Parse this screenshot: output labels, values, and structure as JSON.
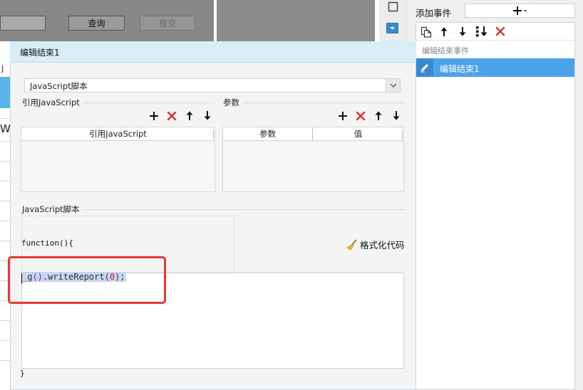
{
  "background_form": {
    "query_label": "查询",
    "submit_label": "提交",
    "left_letter_j": "J",
    "left_letter_w": "W."
  },
  "event_panel": {
    "add_event_label": "添加事件",
    "add_event_dropdown_icon": "plus-icon",
    "toolbar_icons": [
      "copy-icon",
      "arrow-up-icon",
      "arrow-down-icon",
      "move-to-bottom-icon",
      "delete-icon"
    ],
    "category_label": "编辑结束事件",
    "events": [
      {
        "label": "编辑结束1",
        "selected": true,
        "icon": "pencil-icon"
      }
    ]
  },
  "dialog": {
    "title": "编辑结束1",
    "type_select_value": "JavaScript脚本",
    "ref_js": {
      "section_label": "引用JavaScript",
      "columns": [
        "引用JavaScript"
      ],
      "rows": []
    },
    "params": {
      "section_label": "参数",
      "columns": [
        "参数",
        "值"
      ],
      "rows": []
    },
    "script": {
      "section_label": "JavaScript脚本",
      "format_label": "格式化代码",
      "format_icon": "broom-icon",
      "function_open": "function(){",
      "function_close": "}",
      "code_parts": {
        "prefix": "_g",
        "call": "()",
        "method": ".writeReport(",
        "arg": "0",
        "suffix": ");"
      }
    }
  },
  "colors": {
    "accent_blue": "#4da3ea",
    "dialog_header": "#d9edf8",
    "delete_red": "#e0312b",
    "highlight_red": "#e43a36"
  }
}
